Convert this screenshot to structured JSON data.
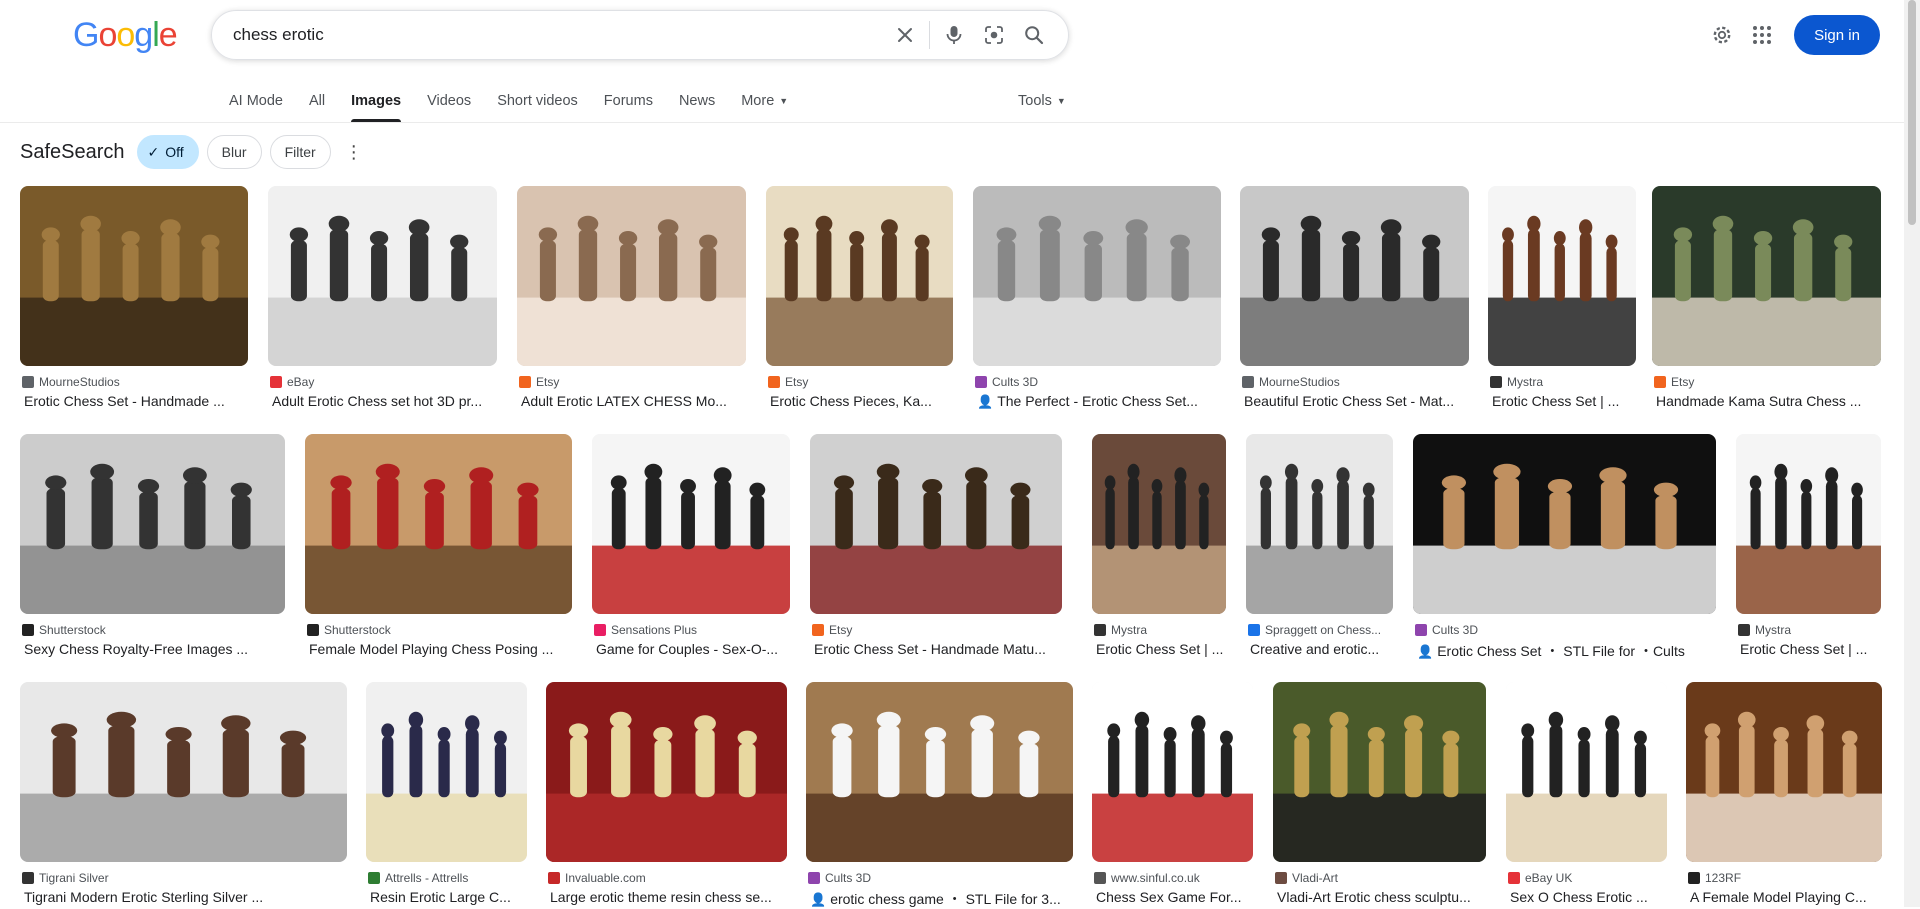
{
  "logo": {
    "letters": [
      "G",
      "o",
      "o",
      "g",
      "l",
      "e"
    ],
    "colors": [
      "#4285f4",
      "#ea4335",
      "#fbbc05",
      "#4285f4",
      "#34a853",
      "#ea4335"
    ]
  },
  "search": {
    "query": "chess erotic"
  },
  "header": {
    "sign_in": "Sign in"
  },
  "tabs": [
    {
      "label": "AI Mode"
    },
    {
      "label": "All"
    },
    {
      "label": "Images",
      "active": true
    },
    {
      "label": "Videos"
    },
    {
      "label": "Short videos"
    },
    {
      "label": "Forums"
    },
    {
      "label": "News"
    },
    {
      "label": "More",
      "dropdown": true
    }
  ],
  "tools": {
    "label": "Tools"
  },
  "safesearch": {
    "title": "SafeSearch",
    "chips": [
      {
        "label": "Off",
        "selected": true
      },
      {
        "label": "Blur"
      },
      {
        "label": "Filter"
      }
    ]
  },
  "results": [
    {
      "source": "MourneStudios",
      "title": "Erotic Chess Set - Handmade ...",
      "fav": "#5f6368",
      "bg": [
        "#7a5a2a",
        "#a07a40",
        "#3a2a18"
      ]
    },
    {
      "source": "eBay",
      "title": "Adult Erotic Chess set hot 3D pr...",
      "fav": "#e53238",
      "bg": [
        "#f0f0f0",
        "#333333",
        "#cfcfcf"
      ]
    },
    {
      "source": "Etsy",
      "title": "Adult Erotic LATEX CHESS Mo...",
      "fav": "#f1641e",
      "bg": [
        "#d9c3b0",
        "#8a6a50",
        "#f2e6dc"
      ]
    },
    {
      "source": "Etsy",
      "title": "Erotic Chess Pieces, Ka...",
      "fav": "#f1641e",
      "bg": [
        "#e8dcc2",
        "#5a3a22",
        "#8a6a4a"
      ]
    },
    {
      "source": "Cults 3D",
      "title": "The Perfect - Erotic Chess Set...",
      "fav": "#8e44ad",
      "pfx": "👤",
      "bg": [
        "#bbbbbb",
        "#888888",
        "#e0e0e0"
      ]
    },
    {
      "source": "MourneStudios",
      "title": "Beautiful Erotic Chess Set - Mat...",
      "fav": "#5f6368",
      "bg": [
        "#c8c8c8",
        "#2a2a2a",
        "#707070"
      ]
    },
    {
      "source": "Mystra",
      "title": "Erotic Chess Set | ...",
      "fav": "#333333",
      "bg": [
        "#f5f5f5",
        "#6a3a22",
        "#222222"
      ]
    },
    {
      "source": "Etsy",
      "title": "Handmade Kama Sutra Chess ...",
      "fav": "#f1641e",
      "bg": [
        "#2a3a2a",
        "#7a8a5a",
        "#d8d0c0"
      ]
    },
    {
      "source": "Shutterstock",
      "title": "Sexy Chess Royalty-Free Images ...",
      "fav": "#222222",
      "bg": [
        "#cccccc",
        "#333333",
        "#888888"
      ]
    },
    {
      "source": "Shutterstock",
      "title": "Female Model Playing Chess Posing ...",
      "fav": "#222222",
      "bg": [
        "#c89a6a",
        "#b02020",
        "#6a4a2a"
      ]
    },
    {
      "source": "Sensations Plus",
      "title": "Game for Couples - Sex-O-...",
      "fav": "#e91e63",
      "bg": [
        "#f5f5f5",
        "#222222",
        "#c02020"
      ]
    },
    {
      "source": "Etsy",
      "title": "Erotic Chess Set - Handmade Matu...",
      "fav": "#f1641e",
      "bg": [
        "#d0d0d0",
        "#3a2a1a",
        "#8a2a2a"
      ]
    },
    {
      "source": "Mystra",
      "title": "Erotic Chess Set | ...",
      "fav": "#333333",
      "bg": [
        "#6a4a3a",
        "#222222",
        "#c0a080"
      ]
    },
    {
      "source": "Spraggett on Chess...",
      "title": "Creative and erotic...",
      "fav": "#1a73e8",
      "bg": [
        "#e8e8e8",
        "#333333",
        "#999999"
      ]
    },
    {
      "source": "Cults 3D",
      "title": "Erotic Chess Set ・ STL File for ・Cults",
      "fav": "#8e44ad",
      "pfx": "👤",
      "bg": [
        "#101010",
        "#c09060",
        "#f0f0f0"
      ]
    },
    {
      "source": "Mystra",
      "title": "Erotic Chess Set | ...",
      "fav": "#333333",
      "bg": [
        "#f5f5f5",
        "#222222",
        "#8a4a2a"
      ]
    },
    {
      "source": "Tigrani Silver",
      "title": "Tigrani Modern Erotic Sterling Silver ...",
      "fav": "#333333",
      "bg": [
        "#e8e8e8",
        "#5a3a2a",
        "#a0a0a0"
      ]
    },
    {
      "source": "Attrells - Attrells",
      "title": "Resin Erotic Large C...",
      "fav": "#2e7d32",
      "bg": [
        "#f0f0f0",
        "#2a2a4a",
        "#e8dcb0"
      ]
    },
    {
      "source": "Invaluable.com",
      "title": "Large erotic theme resin chess se...",
      "fav": "#c62828",
      "bg": [
        "#8a1a1a",
        "#e8d8a0",
        "#b02a2a"
      ]
    },
    {
      "source": "Cults 3D",
      "title": "erotic chess game ・ STL File for 3...",
      "fav": "#8e44ad",
      "pfx": "👤",
      "bg": [
        "#a07a50",
        "#f5f5f5",
        "#5a3a22"
      ]
    },
    {
      "source": "www.sinful.co.uk",
      "title": "Chess Sex Game For...",
      "fav": "#555555",
      "bg": [
        "#ffffff",
        "#222222",
        "#c02020"
      ]
    },
    {
      "source": "Vladi-Art",
      "title": "Vladi-Art Erotic chess sculptu...",
      "fav": "#6d4c41",
      "bg": [
        "#4a5a2a",
        "#c0a050",
        "#202020"
      ]
    },
    {
      "source": "eBay UK",
      "title": "Sex O Chess Erotic ...",
      "fav": "#e53238",
      "bg": [
        "#ffffff",
        "#222222",
        "#e0d0b0"
      ]
    },
    {
      "source": "123RF",
      "title": "A Female Model Playing C...",
      "fav": "#222222",
      "bg": [
        "#6a3a1a",
        "#d0a070",
        "#f0e0d0"
      ]
    }
  ]
}
